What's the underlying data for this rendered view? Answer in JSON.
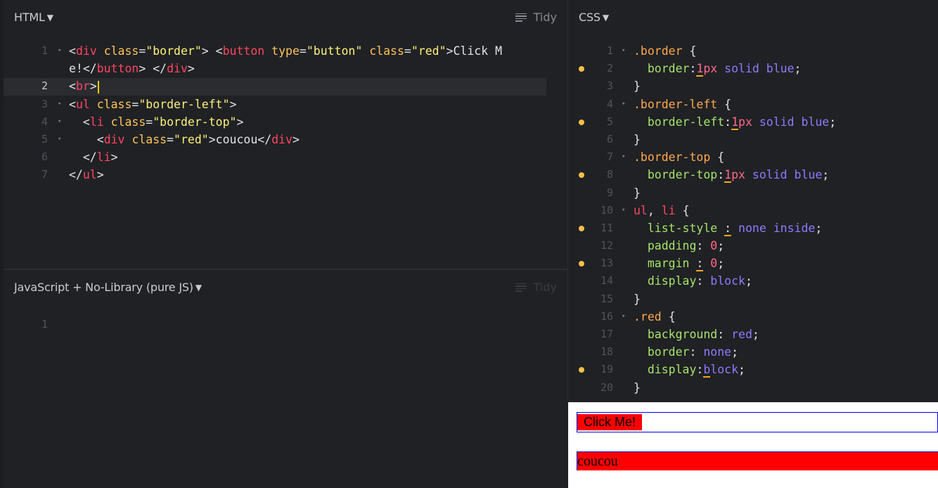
{
  "html_panel": {
    "title": "HTML",
    "tidy_label": "Tidy",
    "lines": [
      {
        "n": "1",
        "fold": "▾",
        "html": "<span class='t-plain'>&lt;</span><span class='t-tag'>div</span> <span class='t-attr'>class</span><span class='t-plain'>=</span><span class='t-str'>\"border\"</span><span class='t-plain'>&gt; &lt;</span><span class='t-tag'>button</span> <span class='t-attr'>type</span><span class='t-plain'>=</span><span class='t-str'>\"button\"</span> <span class='t-attr'>class</span><span class='t-plain'>=</span><span class='t-str'>\"red\"</span><span class='t-plain'>&gt;Click M</span>"
      },
      {
        "n": "",
        "fold": "",
        "html": "<span class='t-plain'>e!&lt;/</span><span class='t-tag'>button</span><span class='t-plain'>&gt; &lt;/</span><span class='t-tag'>div</span><span class='t-plain'>&gt;</span>"
      },
      {
        "n": "2",
        "fold": "",
        "active": true,
        "html": "<span class='t-plain'>&lt;</span><span class='t-tag'>br</span><span class='t-plain'>&gt;</span><span class='cursor'></span>"
      },
      {
        "n": "3",
        "fold": "▾",
        "html": "<span class='t-plain'>&lt;</span><span class='t-tag'>ul</span> <span class='t-attr'>class</span><span class='t-plain'>=</span><span class='t-str'>\"border-left\"</span><span class='t-plain'>&gt;</span>"
      },
      {
        "n": "4",
        "fold": "▾",
        "html": "  <span class='t-plain'>&lt;</span><span class='t-tag'>li</span> <span class='t-attr'>class</span><span class='t-plain'>=</span><span class='t-str'>\"border-top\"</span><span class='t-plain'>&gt;</span>"
      },
      {
        "n": "5",
        "fold": "▾",
        "html": "    <span class='t-plain'>&lt;</span><span class='t-tag'>div</span> <span class='t-attr'>class</span><span class='t-plain'>=</span><span class='t-str'>\"red\"</span><span class='t-plain'>&gt;coucou&lt;/</span><span class='t-tag'>div</span><span class='t-plain'>&gt;</span>"
      },
      {
        "n": "6",
        "fold": "",
        "html": "  <span class='t-plain'>&lt;/</span><span class='t-tag'>li</span><span class='t-plain'>&gt;</span>"
      },
      {
        "n": "7",
        "fold": "",
        "html": "<span class='t-plain'>&lt;/</span><span class='t-tag'>ul</span><span class='t-plain'>&gt;</span>"
      }
    ]
  },
  "js_panel": {
    "title": "JavaScript + No-Library (pure JS)",
    "tidy_label": "Tidy",
    "lines": [
      {
        "n": "1",
        "fold": "",
        "html": ""
      }
    ]
  },
  "css_panel": {
    "title": "CSS",
    "lines": [
      {
        "n": "1",
        "fold": "▾",
        "dot": false,
        "html": "<span class='t-sel'>.border</span> <span class='t-plain'>{</span>"
      },
      {
        "n": "2",
        "fold": "",
        "dot": true,
        "html": "  <span class='t-prop'>border</span><span class='t-plain'>:</span><span class='t-num uline'>1</span><span class='t-num'>px</span> <span class='t-val'>solid</span> <span class='t-val'>blue</span><span class='t-plain'>;</span>"
      },
      {
        "n": "3",
        "fold": "",
        "dot": false,
        "html": "<span class='t-plain'>}</span>"
      },
      {
        "n": "4",
        "fold": "▾",
        "dot": false,
        "html": "<span class='t-sel'>.border-left</span> <span class='t-plain'>{</span>"
      },
      {
        "n": "5",
        "fold": "",
        "dot": true,
        "html": "  <span class='t-prop'>border-left</span><span class='t-plain'>:</span><span class='t-num uline'>1</span><span class='t-num'>px</span> <span class='t-val'>solid</span> <span class='t-val'>blue</span><span class='t-plain'>;</span>"
      },
      {
        "n": "6",
        "fold": "",
        "dot": false,
        "html": "<span class='t-plain'>}</span>"
      },
      {
        "n": "7",
        "fold": "▾",
        "dot": false,
        "html": "<span class='t-sel'>.border-top</span> <span class='t-plain'>{</span>"
      },
      {
        "n": "8",
        "fold": "",
        "dot": true,
        "html": "  <span class='t-prop'>border-top</span><span class='t-plain'>:</span><span class='t-num uline'>1</span><span class='t-num'>px</span> <span class='t-val'>solid</span> <span class='t-val'>blue</span><span class='t-plain'>;</span>"
      },
      {
        "n": "9",
        "fold": "",
        "dot": false,
        "html": "<span class='t-plain'>}</span>"
      },
      {
        "n": "10",
        "fold": "▾",
        "dot": false,
        "html": "<span class='t-tag'>ul</span><span class='t-plain'>, </span><span class='t-tag'>li</span> <span class='t-plain'>{</span>"
      },
      {
        "n": "11",
        "fold": "",
        "dot": true,
        "html": "  <span class='t-prop'>list-style</span> <span class='t-plain uline'>:</span> <span class='t-val'>none</span> <span class='t-val'>inside</span><span class='t-plain'>;</span>"
      },
      {
        "n": "12",
        "fold": "",
        "dot": false,
        "html": "  <span class='t-prop'>padding</span><span class='t-plain'>: </span><span class='t-num'>0</span><span class='t-plain'>;</span>"
      },
      {
        "n": "13",
        "fold": "",
        "dot": true,
        "html": "  <span class='t-prop'>margin</span> <span class='t-plain uline'>:</span> <span class='t-num'>0</span><span class='t-plain'>;</span>"
      },
      {
        "n": "14",
        "fold": "",
        "dot": false,
        "html": "  <span class='t-prop'>display</span><span class='t-plain'>: </span><span class='t-val'>block</span><span class='t-plain'>;</span>"
      },
      {
        "n": "15",
        "fold": "",
        "dot": false,
        "html": "<span class='t-plain'>}</span>"
      },
      {
        "n": "16",
        "fold": "▾",
        "dot": false,
        "html": "<span class='t-sel'>.red</span> <span class='t-plain'>{</span>"
      },
      {
        "n": "17",
        "fold": "",
        "dot": false,
        "html": "  <span class='t-prop'>background</span><span class='t-plain'>: </span><span class='t-val'>red</span><span class='t-plain'>;</span>"
      },
      {
        "n": "18",
        "fold": "",
        "dot": false,
        "html": "  <span class='t-prop'>border</span><span class='t-plain'>: </span><span class='t-val'>none</span><span class='t-plain'>;</span>"
      },
      {
        "n": "19",
        "fold": "",
        "dot": true,
        "html": "  <span class='t-prop'>display</span><span class='t-plain'>:</span><span class='t-val uline'>b</span><span class='t-val'>lock</span><span class='t-plain'>;</span>"
      },
      {
        "n": "20",
        "fold": "",
        "dot": false,
        "html": "<span class='t-plain'>}</span>"
      }
    ]
  },
  "result": {
    "button_label": "Click Me!",
    "div_text": "coucou"
  }
}
